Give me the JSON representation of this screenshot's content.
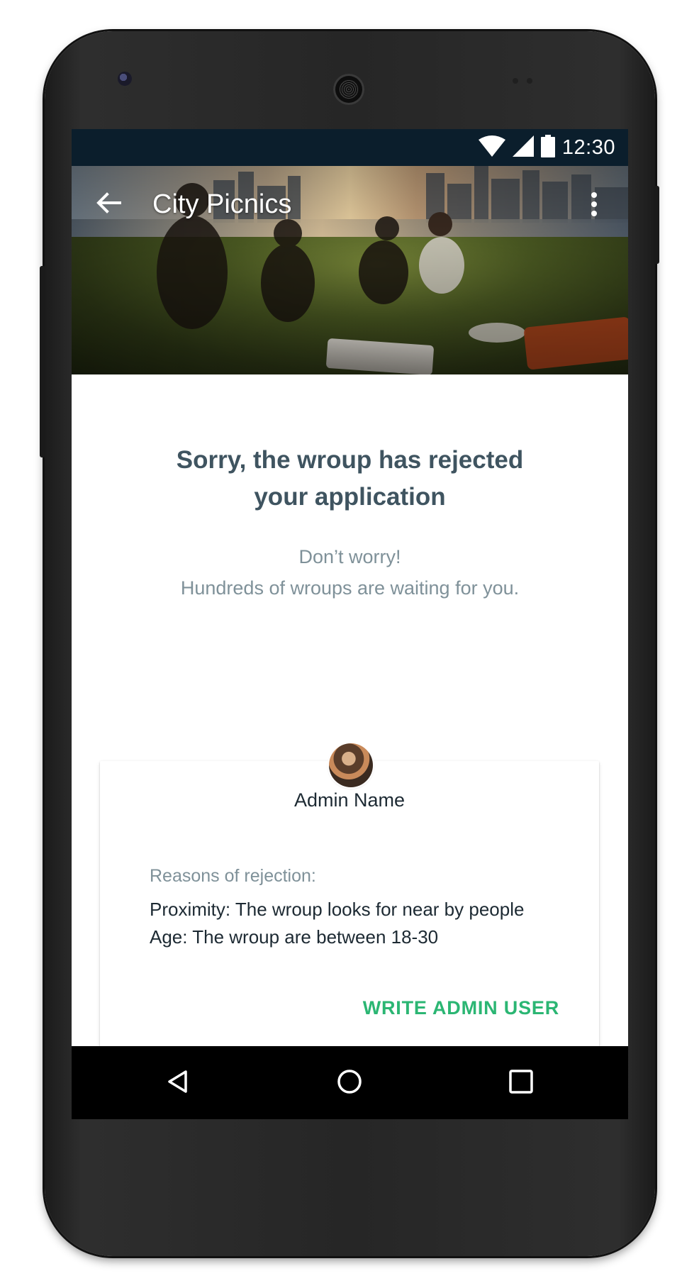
{
  "status_bar": {
    "time": "12:30",
    "icons": [
      "wifi-icon",
      "cell-signal-icon",
      "battery-icon"
    ]
  },
  "toolbar": {
    "title": "City Picnics",
    "back_icon": "arrow-back-icon",
    "menu_icon": "more-vert-icon"
  },
  "main": {
    "heading_line1": "Sorry, the wroup has rejected",
    "heading_line2": "your application",
    "sub_line1": "Don’t worry!",
    "sub_line2": "Hundreds of wroups are waiting for you."
  },
  "card": {
    "admin_name": "Admin Name",
    "reasons_label": "Reasons of rejection:",
    "reasons": [
      "Proximity: The wroup looks for near by people",
      "Age: The wroup are between 18-30"
    ],
    "action_label": "WRITE ADMIN USER"
  },
  "nav_bar": {
    "icons": [
      "back-triangle-icon",
      "home-circle-icon",
      "recents-square-icon"
    ]
  },
  "colors": {
    "status_bar": "#0b1e2c",
    "heading": "#3f5460",
    "subtext": "#7f9199",
    "accent": "#2bb673",
    "body_text": "#1d2a33"
  }
}
